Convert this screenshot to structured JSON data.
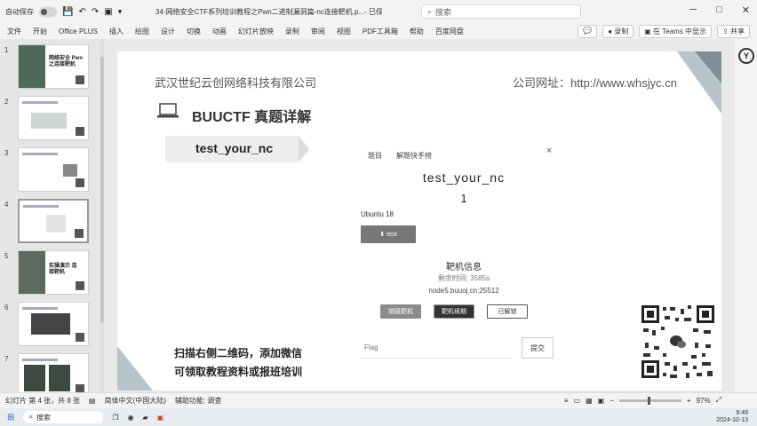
{
  "titlebar": {
    "autosave_label": "自动保存",
    "title": "34-网络安全CTF系列培训教程之Pwn二进制漏洞篇-nc连接靶机.p...",
    "saved_status": "- 已保存到这台电脑",
    "search_placeholder": "搜索"
  },
  "menu": {
    "items": [
      "文件",
      "开始",
      "Office PLUS",
      "插入",
      "绘图",
      "设计",
      "切换",
      "动画",
      "幻灯片放映",
      "录制",
      "审阅",
      "视图",
      "PDF工具箱",
      "帮助",
      "百度网盘"
    ],
    "record_label": "录制",
    "teams_label": "在 Teams 中显示",
    "share_label": "共享"
  },
  "thumbnails": [
    {
      "num": "1",
      "label": "网络安全 Pwn之连接靶机"
    },
    {
      "num": "2",
      "label": ""
    },
    {
      "num": "3",
      "label": ""
    },
    {
      "num": "4",
      "label": ""
    },
    {
      "num": "5",
      "label": "实操演示 连接靶机"
    },
    {
      "num": "6",
      "label": ""
    },
    {
      "num": "7",
      "label": ""
    }
  ],
  "slide": {
    "company": "武汉世纪云创网络科技有限公司",
    "website": "公司网址：http://www.whsjyc.cn",
    "heading": "BUUCTF 真题详解",
    "banner": "test_your_nc",
    "challenge": {
      "tab1": "题目",
      "tab2": "解题快手榜",
      "close": "×",
      "title": "test_your_nc",
      "score": "1",
      "os": "Ubuntu 18",
      "download_label": "test"
    },
    "machine": {
      "title": "靶机信息",
      "time": "剩余时间: 3585s",
      "address": "node5.buuoj.cn:25512",
      "btn_destroy": "销毁靶机",
      "btn_renew": "靶机续期",
      "btn_solved": "已解锁"
    },
    "flag_placeholder": "Flag",
    "submit_label": "提交",
    "promo_line1": "扫描右侧二维码，添加微信",
    "promo_line2": "可领取教程资料或报班培训"
  },
  "statusbar": {
    "slide_info": "幻灯片 第 4 张，共 8 张",
    "language": "简体中文(中国大陆)",
    "accessibility": "辅助功能: 调查",
    "zoom": "97%"
  },
  "taskbar": {
    "search_label": "搜索",
    "time": "9:49",
    "date": "2024-10-13"
  }
}
